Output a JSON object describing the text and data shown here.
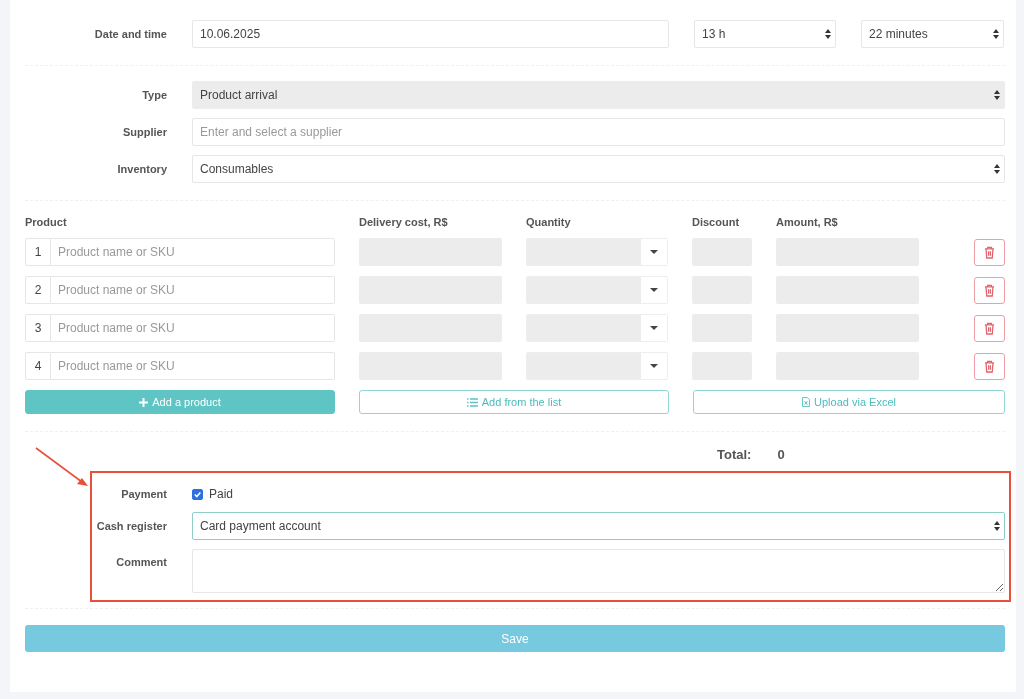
{
  "date_time": {
    "label": "Date and time",
    "date": "10.06.2025",
    "hour": "13 h",
    "minutes": "22 minutes"
  },
  "type": {
    "label": "Type",
    "value": "Product arrival",
    "disabled": true
  },
  "supplier": {
    "label": "Supplier",
    "placeholder": "Enter and select a supplier"
  },
  "inventory": {
    "label": "Inventory",
    "value": "Consumables"
  },
  "products": {
    "columns": [
      "Product",
      "Delivery cost, R$",
      "Quantity",
      "Discount",
      "Amount, R$"
    ],
    "rows": [
      {
        "number": "1",
        "placeholder": "Product name or SKU"
      },
      {
        "number": "2",
        "placeholder": "Product name or SKU"
      },
      {
        "number": "3",
        "placeholder": "Product name or SKU"
      },
      {
        "number": "4",
        "placeholder": "Product name or SKU"
      }
    ]
  },
  "actions": {
    "add_product": "Add a product",
    "add_from_list": "Add from the list",
    "upload_excel": "Upload via Excel"
  },
  "total": {
    "label": "Total:",
    "value": "0"
  },
  "payment": {
    "label": "Payment",
    "checkbox_label": "Paid",
    "checked": true
  },
  "cash_register": {
    "label": "Cash register",
    "value": "Card payment account"
  },
  "comment": {
    "label": "Comment"
  },
  "save_button": "Save"
}
